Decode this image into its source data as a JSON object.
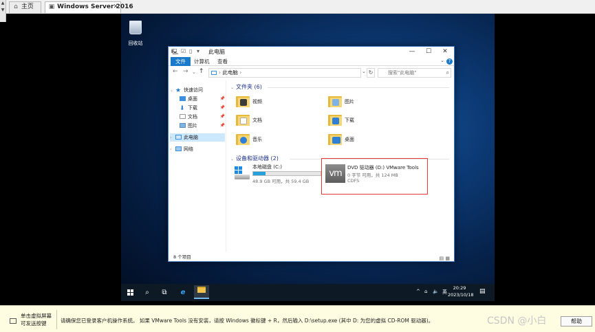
{
  "host": {
    "tabs": [
      {
        "label": "主页",
        "icon": "home-icon"
      },
      {
        "label": "Windows Server 2016",
        "icon": "vm-icon"
      }
    ]
  },
  "desktop": {
    "recycle_bin_label": "回收站"
  },
  "explorer": {
    "title": "此电脑",
    "ribbon_tabs": [
      "文件",
      "计算机",
      "查看"
    ],
    "address_path": "此电脑",
    "search_placeholder": "搜索\"此电脑\"",
    "nav": {
      "quick_access": "快速访问",
      "items": [
        "桌面",
        "下载",
        "文档",
        "图片"
      ],
      "this_pc": "此电脑",
      "network": "网络"
    },
    "folders_header": "文件夹 (6)",
    "folders": [
      {
        "label": "视频",
        "badge": "#3b3b3b"
      },
      {
        "label": "图片",
        "badge": "#7fb2e5"
      },
      {
        "label": "文档",
        "badge": "#ffffff"
      },
      {
        "label": "下载",
        "badge": "#2f7fd6"
      },
      {
        "label": "音乐",
        "badge": "#2f7fd6"
      },
      {
        "label": "桌面",
        "badge": "#2f7fd6"
      }
    ],
    "devices_header": "设备和驱动器 (2)",
    "drives": [
      {
        "name": "本地磁盘 (C:)",
        "detail": "48.9 GB 可用，共 59.4 GB",
        "used_fraction": 0.18
      },
      {
        "name": "DVD 驱动器 (D:) VMware Tools",
        "detail": "0 字节 可用，共 124 MB",
        "fs": "CDFS",
        "logo": "vm"
      }
    ],
    "status": "8 个项目",
    "accent": "#1979ca"
  },
  "taskbar": {
    "tray_lang": "英",
    "time": "20:29",
    "date": "2023/10/18"
  },
  "hint": {
    "left_line1": "单击虚拟屏幕",
    "left_line2": "可发送按键",
    "message": "请确保您已登录客户机操作系统。 如果 VMware Tools 没有安装，请按 Windows 徽标键 + R，然后输入 D:\\setup.exe (其中 D: 为您的虚拟 CD-ROM 驱动器)。",
    "watermark": "CSDN @小白",
    "help_label": "帮助"
  }
}
